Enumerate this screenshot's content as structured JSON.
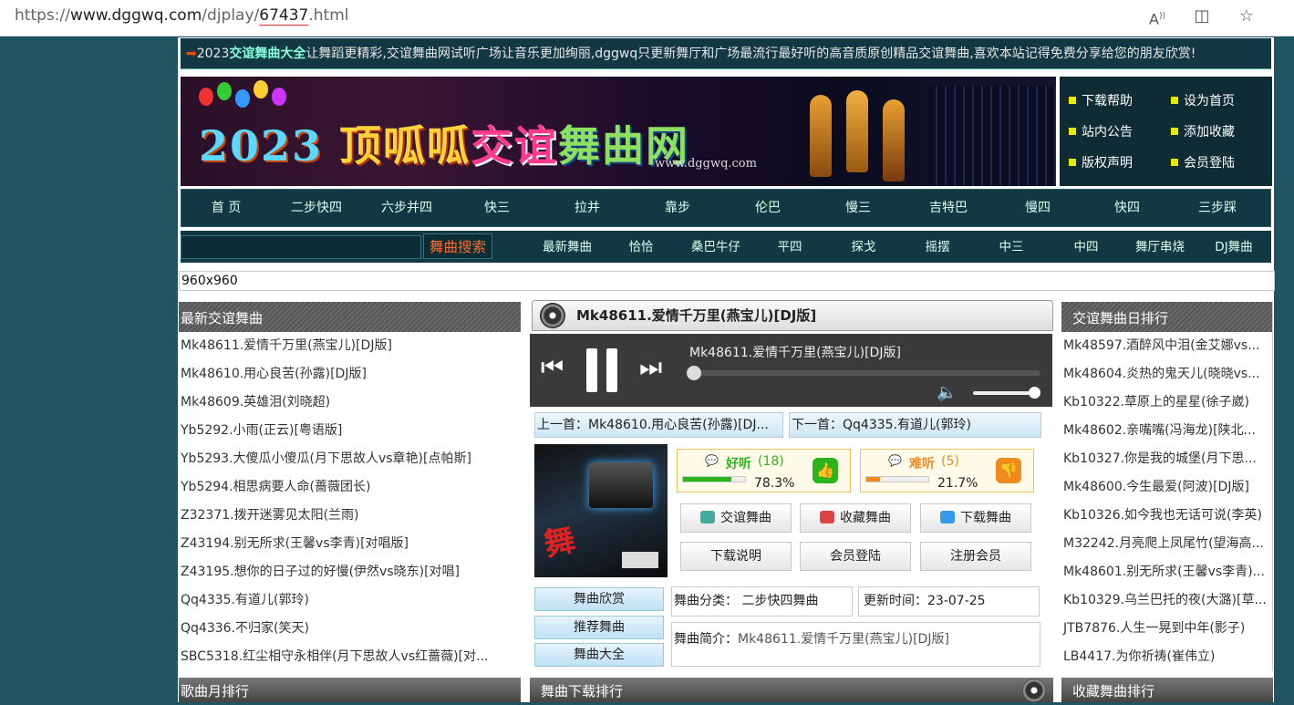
{
  "browser": {
    "url_scheme": "https://",
    "url_domain": "www.dggwq.com",
    "url_path1": "/djplay/",
    "url_id": "67437",
    "url_ext": ".html",
    "read_aloud_icon": "read-aloud-icon",
    "reader_icon": "reader-view-icon",
    "favorite_icon": "star-icon"
  },
  "marquee": {
    "arrow": "➡",
    "year": "2023",
    "highlight": "交谊舞曲大全",
    "text": "让舞蹈更精彩,交谊舞曲网试听广场让音乐更加绚丽,dggwq只更新舞厅和广场最流行最好听的高音质原创精品交谊舞曲,喜欢本站记得免费分享给您的朋友欣赏!"
  },
  "banner": {
    "logo_year": "2023",
    "logo_text1": "顶呱呱",
    "logo_text2": "交谊",
    "logo_text3": "舞曲网",
    "site": "www.dggwq.com"
  },
  "quick_links": [
    "下载帮助",
    "设为首页",
    "站内公告",
    "添加收藏",
    "版权声明",
    "会员登陆"
  ],
  "nav1": [
    "首 页",
    "二步快四",
    "六步并四",
    "快三",
    "拉并",
    "靠步",
    "伦巴",
    "慢三",
    "吉特巴",
    "慢四",
    "快四",
    "三步踩"
  ],
  "search": {
    "button": "舞曲搜索",
    "value": ""
  },
  "nav2": [
    "最新舞曲",
    "恰恰",
    "桑巴牛仔",
    "平四",
    "探戈",
    "摇摆",
    "中三",
    "中四",
    "舞厅串烧",
    "DJ舞曲"
  ],
  "size_label": "960x960",
  "left": {
    "title": "最新交谊舞曲",
    "items": [
      "Mk48611.爱情千万里(燕宝儿)[DJ版]",
      "Mk48610.用心良苦(孙露)[DJ版]",
      "Mk48609.英雄泪(刘晓超)",
      "Yb5292.小雨(正云)[粤语版]",
      "Yb5293.大傻瓜小傻瓜(月下思故人vs章艳)[点帕斯]",
      "Yb5294.相思病要人命(蔷薇团长)",
      "Z32371.拨开迷雾见太阳(兰雨)",
      "Z43194.别无所求(王馨vs李青)[对唱版]",
      "Z43195.想你的日子过的好慢(伊然vs晓东)[对唱]",
      "Qq4335.有道儿(郭玲)",
      "Qq4336.不归家(笑天)",
      "SBC5318.红尘相守永相伴(月下思故人vs红蔷薇)[对..."
    ]
  },
  "right": {
    "title": "交谊舞曲日排行",
    "items": [
      "Mk48597.酒醉风中泪(金艾娜vs...",
      "Mk48604.炎热的鬼天儿(晓晓vs...",
      "Kb10322.草原上的星星(徐子崴)",
      "Mk48602.亲嘴嘴(冯海龙)[陕北...",
      "Kb10327.你是我的城堡(月下思...",
      "Mk48600.今生最爱(阿波)[DJ版]",
      "Kb10326.如今我也无话可说(李英)",
      "M32242.月亮爬上凤尾竹(望海高...",
      "Mk48601.别无所求(王馨vs李青)...",
      "Kb10329.乌兰巴托的夜(大潞)[草...",
      "JTB7876.人生一晃到中年(影子)",
      "LB4417.为你祈祷(崔伟立)"
    ]
  },
  "player": {
    "header": "Mk48611.爱情千万里(燕宝儿)[DJ版]",
    "now_playing": "Mk48611.爱情千万里(燕宝儿)[DJ版]",
    "progress": 0,
    "volume": 0.95
  },
  "prev": "上一首：Mk48610.用心良苦(孙露)[DJ...",
  "next": "下一首：Qq4335.有道儿(郭玲)",
  "vote": {
    "good_label": "好听",
    "good_count": "(18)",
    "good_pct": "78.3%",
    "good_frac": 0.783,
    "bad_label": "难听",
    "bad_count": "(5)",
    "bad_pct": "21.7%",
    "bad_frac": 0.217
  },
  "actions": [
    "交谊舞曲",
    "收藏舞曲",
    "下载舞曲",
    "下载说明",
    "会员登陆",
    "注册会员"
  ],
  "side_buttons": [
    "舞曲欣赏",
    "推荐舞曲",
    "舞曲大全"
  ],
  "info": {
    "cat_label": "舞曲分类：",
    "cat_value": "二步快四舞曲",
    "time_label": "更新时间：",
    "time_value": "23-07-25",
    "intro_label": "舞曲简介：",
    "intro_value": "Mk48611.爱情千万里(燕宝儿)[DJ版]"
  },
  "bottom": {
    "left": "歌曲月排行",
    "center": "舞曲下载排行",
    "right": "收藏舞曲排行"
  },
  "colors": {
    "bg": "#1f5563",
    "nav": "#123844",
    "good": "#2bb51c",
    "bad": "#f08a1e",
    "search_btn": "#ff6a2a"
  }
}
